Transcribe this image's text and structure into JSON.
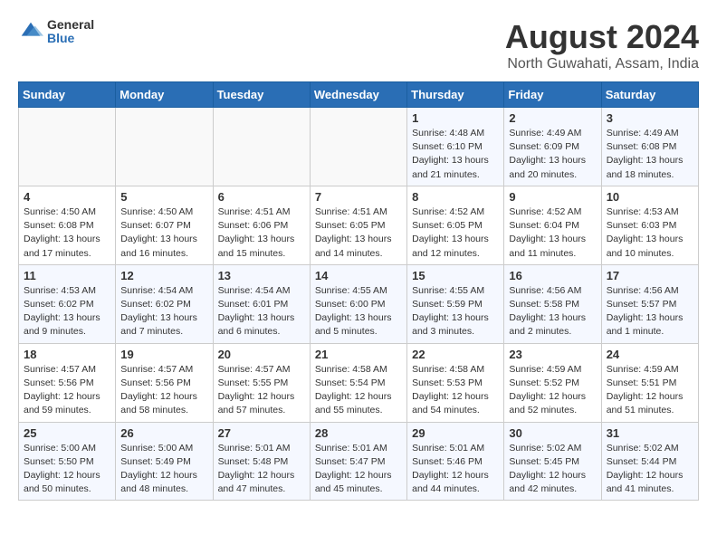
{
  "logo": {
    "general": "General",
    "blue": "Blue"
  },
  "title": "August 2024",
  "location": "North Guwahati, Assam, India",
  "days_of_week": [
    "Sunday",
    "Monday",
    "Tuesday",
    "Wednesday",
    "Thursday",
    "Friday",
    "Saturday"
  ],
  "weeks": [
    [
      {
        "day": "",
        "info": ""
      },
      {
        "day": "",
        "info": ""
      },
      {
        "day": "",
        "info": ""
      },
      {
        "day": "",
        "info": ""
      },
      {
        "day": "1",
        "info": "Sunrise: 4:48 AM\nSunset: 6:10 PM\nDaylight: 13 hours\nand 21 minutes."
      },
      {
        "day": "2",
        "info": "Sunrise: 4:49 AM\nSunset: 6:09 PM\nDaylight: 13 hours\nand 20 minutes."
      },
      {
        "day": "3",
        "info": "Sunrise: 4:49 AM\nSunset: 6:08 PM\nDaylight: 13 hours\nand 18 minutes."
      }
    ],
    [
      {
        "day": "4",
        "info": "Sunrise: 4:50 AM\nSunset: 6:08 PM\nDaylight: 13 hours\nand 17 minutes."
      },
      {
        "day": "5",
        "info": "Sunrise: 4:50 AM\nSunset: 6:07 PM\nDaylight: 13 hours\nand 16 minutes."
      },
      {
        "day": "6",
        "info": "Sunrise: 4:51 AM\nSunset: 6:06 PM\nDaylight: 13 hours\nand 15 minutes."
      },
      {
        "day": "7",
        "info": "Sunrise: 4:51 AM\nSunset: 6:05 PM\nDaylight: 13 hours\nand 14 minutes."
      },
      {
        "day": "8",
        "info": "Sunrise: 4:52 AM\nSunset: 6:05 PM\nDaylight: 13 hours\nand 12 minutes."
      },
      {
        "day": "9",
        "info": "Sunrise: 4:52 AM\nSunset: 6:04 PM\nDaylight: 13 hours\nand 11 minutes."
      },
      {
        "day": "10",
        "info": "Sunrise: 4:53 AM\nSunset: 6:03 PM\nDaylight: 13 hours\nand 10 minutes."
      }
    ],
    [
      {
        "day": "11",
        "info": "Sunrise: 4:53 AM\nSunset: 6:02 PM\nDaylight: 13 hours\nand 9 minutes."
      },
      {
        "day": "12",
        "info": "Sunrise: 4:54 AM\nSunset: 6:02 PM\nDaylight: 13 hours\nand 7 minutes."
      },
      {
        "day": "13",
        "info": "Sunrise: 4:54 AM\nSunset: 6:01 PM\nDaylight: 13 hours\nand 6 minutes."
      },
      {
        "day": "14",
        "info": "Sunrise: 4:55 AM\nSunset: 6:00 PM\nDaylight: 13 hours\nand 5 minutes."
      },
      {
        "day": "15",
        "info": "Sunrise: 4:55 AM\nSunset: 5:59 PM\nDaylight: 13 hours\nand 3 minutes."
      },
      {
        "day": "16",
        "info": "Sunrise: 4:56 AM\nSunset: 5:58 PM\nDaylight: 13 hours\nand 2 minutes."
      },
      {
        "day": "17",
        "info": "Sunrise: 4:56 AM\nSunset: 5:57 PM\nDaylight: 13 hours\nand 1 minute."
      }
    ],
    [
      {
        "day": "18",
        "info": "Sunrise: 4:57 AM\nSunset: 5:56 PM\nDaylight: 12 hours\nand 59 minutes."
      },
      {
        "day": "19",
        "info": "Sunrise: 4:57 AM\nSunset: 5:56 PM\nDaylight: 12 hours\nand 58 minutes."
      },
      {
        "day": "20",
        "info": "Sunrise: 4:57 AM\nSunset: 5:55 PM\nDaylight: 12 hours\nand 57 minutes."
      },
      {
        "day": "21",
        "info": "Sunrise: 4:58 AM\nSunset: 5:54 PM\nDaylight: 12 hours\nand 55 minutes."
      },
      {
        "day": "22",
        "info": "Sunrise: 4:58 AM\nSunset: 5:53 PM\nDaylight: 12 hours\nand 54 minutes."
      },
      {
        "day": "23",
        "info": "Sunrise: 4:59 AM\nSunset: 5:52 PM\nDaylight: 12 hours\nand 52 minutes."
      },
      {
        "day": "24",
        "info": "Sunrise: 4:59 AM\nSunset: 5:51 PM\nDaylight: 12 hours\nand 51 minutes."
      }
    ],
    [
      {
        "day": "25",
        "info": "Sunrise: 5:00 AM\nSunset: 5:50 PM\nDaylight: 12 hours\nand 50 minutes."
      },
      {
        "day": "26",
        "info": "Sunrise: 5:00 AM\nSunset: 5:49 PM\nDaylight: 12 hours\nand 48 minutes."
      },
      {
        "day": "27",
        "info": "Sunrise: 5:01 AM\nSunset: 5:48 PM\nDaylight: 12 hours\nand 47 minutes."
      },
      {
        "day": "28",
        "info": "Sunrise: 5:01 AM\nSunset: 5:47 PM\nDaylight: 12 hours\nand 45 minutes."
      },
      {
        "day": "29",
        "info": "Sunrise: 5:01 AM\nSunset: 5:46 PM\nDaylight: 12 hours\nand 44 minutes."
      },
      {
        "day": "30",
        "info": "Sunrise: 5:02 AM\nSunset: 5:45 PM\nDaylight: 12 hours\nand 42 minutes."
      },
      {
        "day": "31",
        "info": "Sunrise: 5:02 AM\nSunset: 5:44 PM\nDaylight: 12 hours\nand 41 minutes."
      }
    ]
  ]
}
